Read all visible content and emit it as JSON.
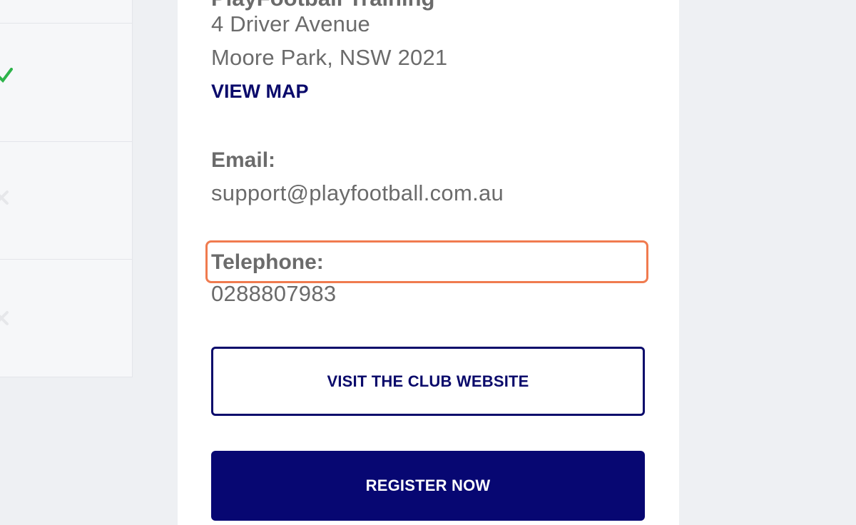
{
  "venue": {
    "name": "PlayFootball Training",
    "address_line1": "4 Driver Avenue",
    "address_line2": "Moore Park, NSW 2021",
    "view_map_label": "VIEW MAP"
  },
  "contact": {
    "email_label": "Email:",
    "email_value": "support@playfootball.com.au",
    "telephone_label": "Telephone:",
    "telephone_value": "0288807983"
  },
  "actions": {
    "visit_website_label": "VISIT THE CLUB WEBSITE",
    "register_label": "REGISTER NOW"
  },
  "icons": {
    "row2": "check-icon",
    "row3": "cross-icon",
    "row4": "cross-icon"
  },
  "colors": {
    "brand_navy": "#070772",
    "highlight": "#f07b4f",
    "check_green": "#2db34a",
    "text_gray": "#6b6b6b"
  }
}
